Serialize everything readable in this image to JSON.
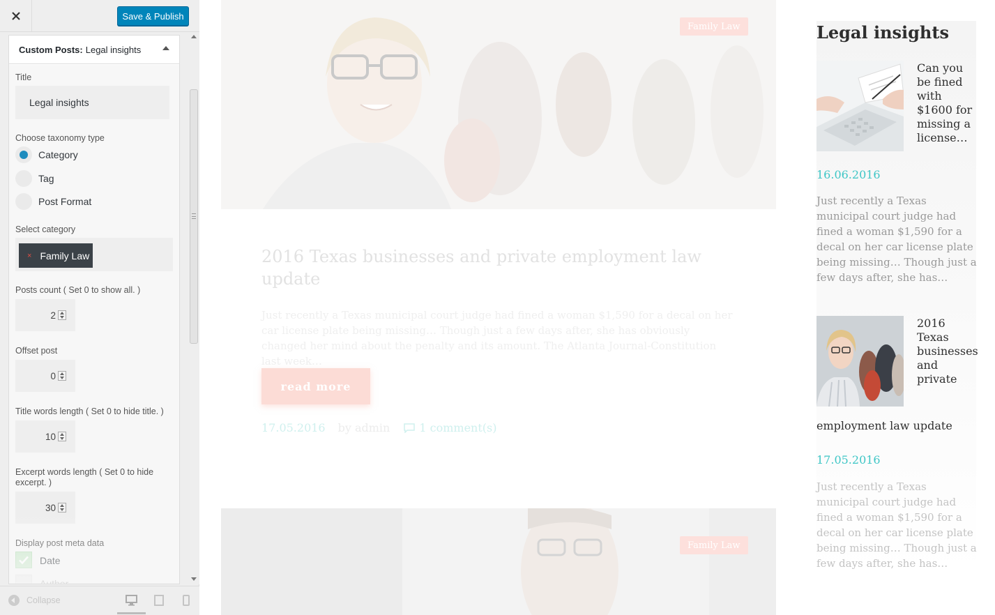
{
  "customizer": {
    "save_label": "Save & Publish",
    "panel_prefix": "Custom Posts:",
    "panel_name": "Legal insights",
    "title_label": "Title",
    "title_value": "Legal insights",
    "taxonomy_label": "Choose taxonomy type",
    "taxonomy_options": [
      "Category",
      "Tag",
      "Post Format"
    ],
    "taxonomy_selected": "Category",
    "category_label": "Select category",
    "category_chip_x": "×",
    "category_chip": "Family Law",
    "posts_count_label": "Posts count ( Set 0 to show all. )",
    "posts_count": "2",
    "offset_label": "Offset post",
    "offset": "0",
    "title_words_label": "Title words length ( Set 0 to hide title. )",
    "title_words": "10",
    "excerpt_words_label": "Excerpt words length ( Set 0 to hide excerpt. )",
    "excerpt_words": "30",
    "meta_label": "Display post meta data",
    "meta_options": [
      "Date",
      "Author"
    ],
    "collapse_label": "Collapse"
  },
  "preview": {
    "badge": "Family Law",
    "badge2": "Family Law",
    "title": "2016 Texas businesses and private employment law update",
    "excerpt": "Just recently a Texas municipal court judge had fined a woman $1,590 for a decal on her car license plate being missing… Though just a few days after, she has obviously changed her mind about the penalty and its amount. The Atlanta Journal-Constitution last week…",
    "read_more": "read more",
    "date": "17.05.2016",
    "author": "by admin",
    "comments": "1 comment(s)"
  },
  "widget": {
    "title": "Legal insights",
    "posts": [
      {
        "title": "Can you be fined with $1600 for missing a license…",
        "date": "16.06.2016",
        "excerpt": "Just recently a Texas municipal court judge had fined a woman $1,590 for a decal on her car license plate being missing… Though just a few days after, she has…"
      },
      {
        "title": "2016 Texas businesses and private",
        "title_cont": "employment law update",
        "date": "17.05.2016",
        "excerpt": "Just recently a Texas municipal court judge had fined a woman $1,590 for a decal on her car license plate being missing… Though just a few days after, she has…"
      }
    ]
  },
  "colors": {
    "primary_button": "#0085ba",
    "accent_teal": "#3ec6c6",
    "badge_pink": "#fde0dc",
    "chip_dark": "#3b4248"
  },
  "icons": [
    "close-icon",
    "collapse-icon",
    "desktop-icon",
    "tablet-icon",
    "mobile-icon",
    "comment-icon",
    "checkmark-icon"
  ]
}
